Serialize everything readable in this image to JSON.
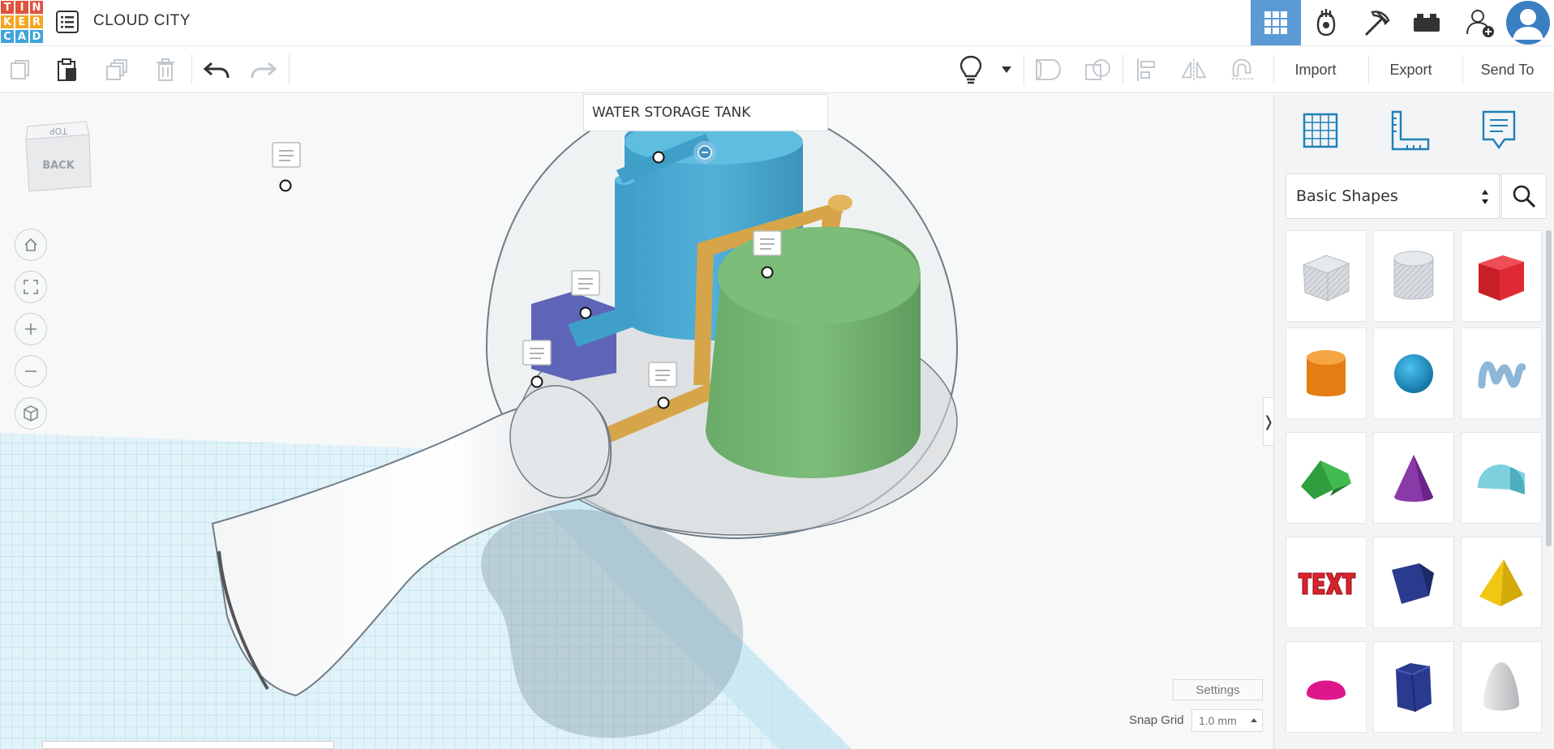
{
  "app": {
    "logo_letters": [
      "T",
      "I",
      "N",
      "K",
      "E",
      "R",
      "C",
      "A",
      "D"
    ],
    "logo_colors": [
      "#e1523d",
      "#e1523d",
      "#e1523d",
      "#f6a623",
      "#f6a623",
      "#f6a623",
      "#3fa4d9",
      "#3fa4d9",
      "#3fa4d9"
    ],
    "project_title": "CLOUD CITY"
  },
  "topbar": {
    "icons": [
      "3d-view-grid-icon",
      "circuits-icon",
      "codeblocks-icon",
      "bricks-icon",
      "add-user-icon",
      "user-avatar-icon"
    ],
    "active_color": "#5b9bd5"
  },
  "toolbar": {
    "import_label": "Import",
    "export_label": "Export",
    "send_to_label": "Send To",
    "icons": [
      "copy-icon",
      "paste-icon",
      "duplicate-icon",
      "delete-icon",
      "undo-icon",
      "redo-icon",
      "lightbulb-icon",
      "dropdown-caret-icon",
      "group-icon",
      "ungroup-icon",
      "align-icon",
      "mirror-icon",
      "magnet-icon"
    ]
  },
  "viewport": {
    "selected_label": "WATER STORAGE TANK",
    "view_cube": {
      "top_face": "TOP",
      "front_face": "BACK"
    },
    "nav_icons": [
      "home-icon",
      "fit-all-icon",
      "zoom-in-icon",
      "zoom-out-icon",
      "ortho-view-icon"
    ],
    "settings_label": "Settings",
    "snap_grid_label": "Snap Grid",
    "snap_grid_value": "1.0 mm",
    "collapse_arrow": "❭"
  },
  "panel": {
    "tabs": [
      "workplane-icon",
      "ruler-icon",
      "notes-icon"
    ],
    "category": "Basic Shapes",
    "shapes": [
      {
        "name": "box-hole",
        "color": "#c9ced4"
      },
      {
        "name": "cylinder-hole",
        "color": "#c9ced4"
      },
      {
        "name": "box",
        "color": "#d9232d"
      },
      {
        "name": "cylinder",
        "color": "#f08a1c"
      },
      {
        "name": "sphere",
        "color": "#1b8fc7"
      },
      {
        "name": "scribble",
        "color": "#8db7d8"
      },
      {
        "name": "roof",
        "color": "#2e9e3e"
      },
      {
        "name": "cone",
        "color": "#8a3aa8"
      },
      {
        "name": "round-roof",
        "color": "#6ec6d6"
      },
      {
        "name": "text",
        "color": "#d9232d"
      },
      {
        "name": "wedge",
        "color": "#2a3b8f"
      },
      {
        "name": "pyramid",
        "color": "#f2c712"
      },
      {
        "name": "half-sphere",
        "color": "#e0168c"
      },
      {
        "name": "polygon",
        "color": "#2a3b8f"
      },
      {
        "name": "paraboloid",
        "color": "#d5d7d9"
      }
    ]
  }
}
